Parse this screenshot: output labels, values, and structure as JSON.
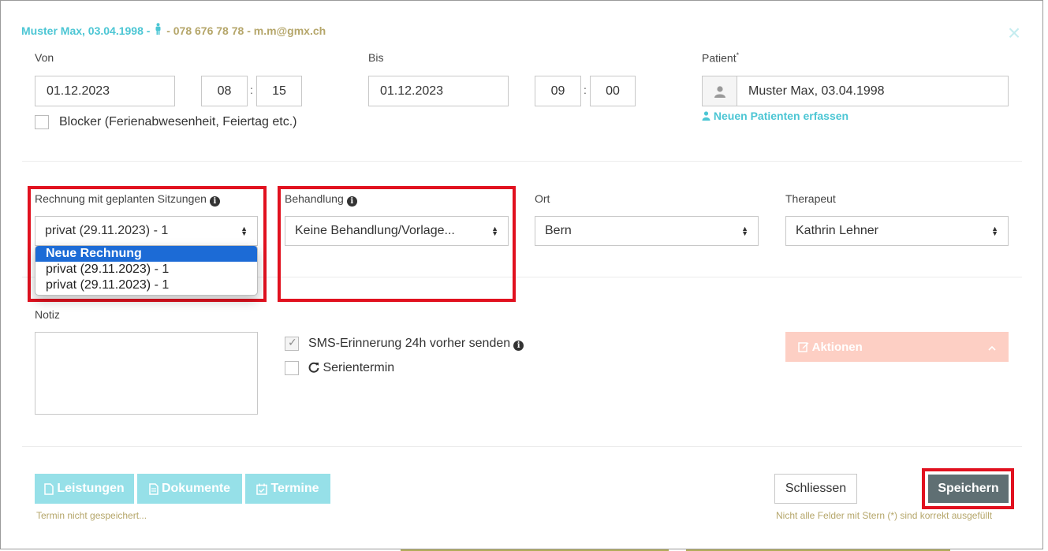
{
  "header": {
    "name_dob": "Muster Max, 03.04.1998",
    "sep1": " - ",
    "contact": " - 078 676 78 78 - m.m@gmx.ch",
    "close_icon": "×"
  },
  "von": {
    "label": "Von",
    "date": "01.12.2023",
    "hour": "08",
    "minute": "15",
    "colon": ":"
  },
  "bis": {
    "label": "Bis",
    "date": "01.12.2023",
    "hour": "09",
    "minute": "00",
    "colon": ":"
  },
  "patient": {
    "label": "Patient",
    "required": "*",
    "value": "Muster Max, 03.04.1998",
    "new_link": "Neuen Patienten erfassen"
  },
  "blocker": {
    "label": "Blocker (Ferienabwesenheit, Feiertag etc.)",
    "checked": false
  },
  "rechnung": {
    "label": "Rechnung mit geplanten Sitzungen",
    "value": "privat (29.11.2023) - 1",
    "options": [
      "Neue Rechnung",
      "privat (29.11.2023) - 1",
      "privat (29.11.2023) - 1"
    ]
  },
  "behandlung": {
    "label": "Behandlung",
    "value": "Keine Behandlung/Vorlage..."
  },
  "ort": {
    "label": "Ort",
    "value": "Bern"
  },
  "therapeut": {
    "label": "Therapeut",
    "value": "Kathrin Lehner"
  },
  "notiz": {
    "label": "Notiz",
    "value": ""
  },
  "sms": {
    "label": "SMS-Erinnerung 24h vorher senden",
    "checked": true
  },
  "serie": {
    "label": "Serientermin",
    "checked": false
  },
  "actions": {
    "label": "Aktionen"
  },
  "footer": {
    "leistungen": "Leistungen",
    "dokumente": "Dokumente",
    "termine": "Termine",
    "not_saved": "Termin nicht gespeichert...",
    "close": "Schliessen",
    "save": "Speichern",
    "required_note": "Nicht alle Felder mit Stern (*) sind korrekt ausgefüllt"
  },
  "colors": {
    "teal": "#4cc6d4",
    "gold": "#b5a66a",
    "red_highlight": "#e1111f",
    "save_bg": "#5f6f73",
    "teal_button": "#96e0e8",
    "actions_bg": "#fdcfc4"
  }
}
